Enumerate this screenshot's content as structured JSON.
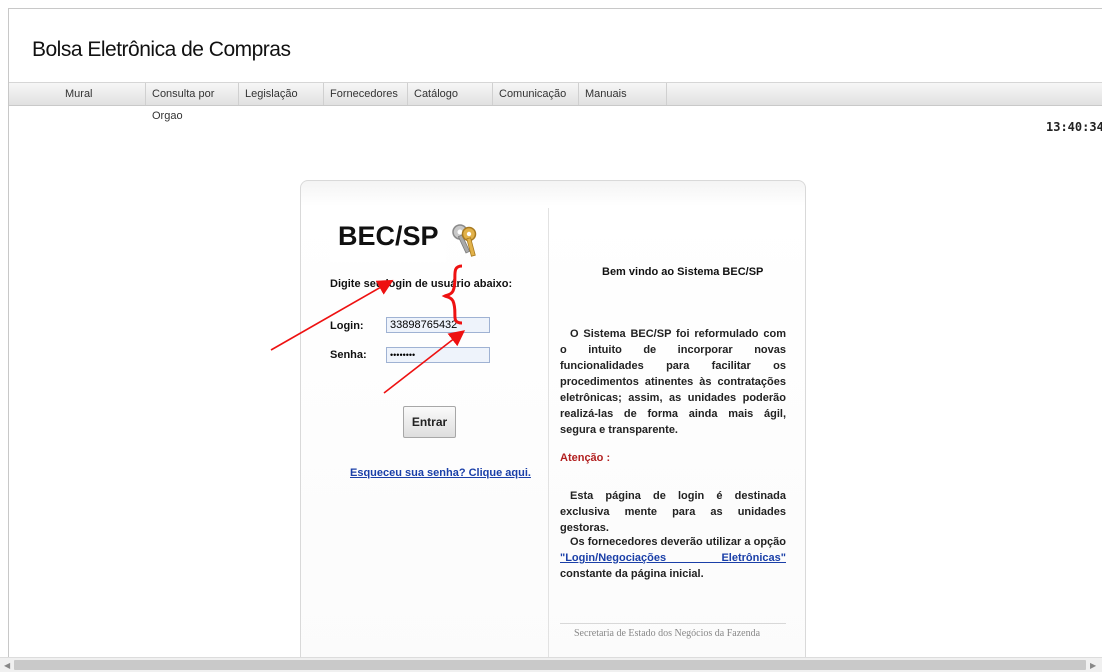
{
  "app": {
    "title": "Bolsa Eletrônica de Compras"
  },
  "nav": {
    "items": [
      {
        "label": "Mural"
      },
      {
        "label": "Consulta por Orgao"
      },
      {
        "label": "Legislação"
      },
      {
        "label": "Fornecedores"
      },
      {
        "label": "Catálogo"
      },
      {
        "label": "Comunicação"
      },
      {
        "label": "Manuais"
      }
    ]
  },
  "clock": "13:40:34",
  "login": {
    "logo": "BEC/SP",
    "logo_icon": "keys-icon",
    "prompt": "Digite seu login de usuário abaixo:",
    "login_label": "Login:",
    "login_value": "33898765432",
    "password_label": "Senha:",
    "password_value": "••••••••",
    "submit_label": "Entrar",
    "forgot_link": "Esqueceu sua senha? Clique aqui."
  },
  "info": {
    "welcome": "Bem vindo ao Sistema BEC/SP",
    "description": "O Sistema BEC/SP foi reformulado com o intuito de incorporar novas funcionalidades para facilitar os procedimentos atinentes às contratações eletrônicas; assim, as unidades poderão realizá-las de forma ainda mais ágil, segura e transparente.",
    "attention_label": "Atenção :",
    "notice": "Esta página de login é destinada exclusiva mente para as unidades gestoras.",
    "suppliers_prefix": "Os fornecedores deverão utilizar a opção",
    "suppliers_link": "\"Login/Negociações Eletrônicas\"",
    "suppliers_suffix": "constante da página inicial.",
    "footer": "Secretaria de Estado dos Negócios da Fazenda"
  },
  "colors": {
    "annotation": "#ee1111",
    "link": "#1a3fa8",
    "attention": "#b22020"
  }
}
